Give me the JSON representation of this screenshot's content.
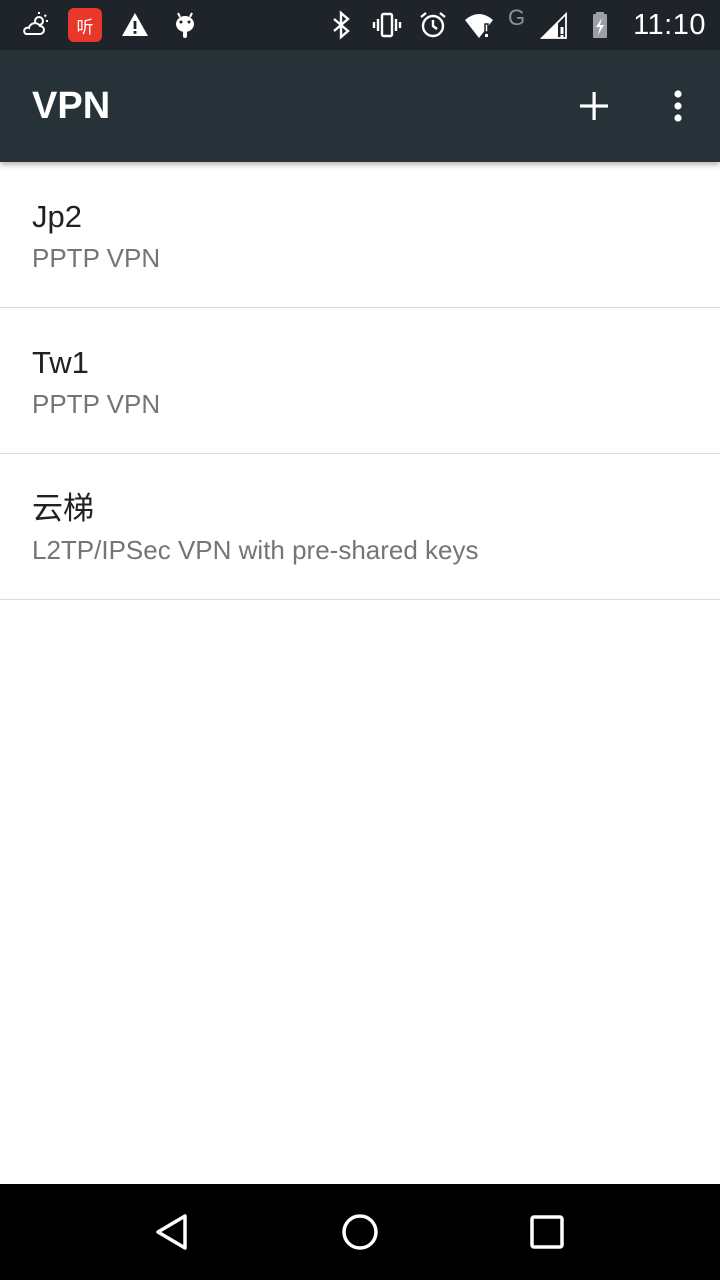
{
  "status_bar": {
    "left_icons": [
      "weather-icon",
      "ting-app-icon",
      "warning-icon",
      "android-icon"
    ],
    "ting_label": "听",
    "right_icons": [
      "bluetooth-icon",
      "vibrate-icon",
      "alarm-icon",
      "wifi-icon",
      "cell-signal-icon",
      "battery-charging-icon"
    ],
    "network_letter": "G",
    "time": "11:10"
  },
  "app_bar": {
    "title": "VPN",
    "background": "#263238",
    "actions": [
      "add-icon",
      "more-vert-icon"
    ]
  },
  "vpn_list": [
    {
      "name": "Jp2",
      "type": "PPTP VPN"
    },
    {
      "name": "Tw1",
      "type": "PPTP VPN"
    },
    {
      "name": "云梯",
      "type": "L2TP/IPSec VPN with pre-shared keys"
    }
  ],
  "nav_bar": {
    "buttons": [
      "back-icon",
      "home-icon",
      "recents-icon"
    ]
  }
}
